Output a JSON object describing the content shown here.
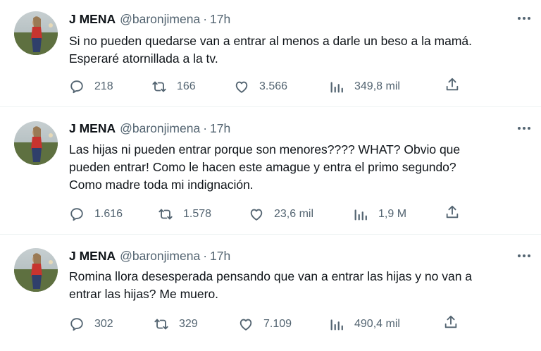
{
  "tweets": [
    {
      "name": "J MENA",
      "handle": "@baronjimena",
      "separator": "·",
      "time": "17h",
      "text": "Si no pueden quedarse van a entrar al menos a darle un beso a la mamá.\nEsperaré atornillada a la tv.",
      "replies": "218",
      "retweets": "166",
      "likes": "3.566",
      "views": "349,8 mil"
    },
    {
      "name": "J MENA",
      "handle": "@baronjimena",
      "separator": "·",
      "time": "17h",
      "text": "Las hijas ni pueden entrar porque son menores???? WHAT? Obvio que\npueden entrar! Como le hacen este amague y entra el primo segundo?\nComo madre toda mi indignación.",
      "replies": "1.616",
      "retweets": "1.578",
      "likes": "23,6 mil",
      "views": "1,9 M"
    },
    {
      "name": "J MENA",
      "handle": "@baronjimena",
      "separator": "·",
      "time": "17h",
      "text": "Romina llora desesperada pensando que van a entrar las hijas y no van a\nentrar las hijas? Me muero.",
      "replies": "302",
      "retweets": "329",
      "likes": "7.109",
      "views": "490,4 mil"
    }
  ],
  "icons": {
    "reply": "reply-icon",
    "retweet": "retweet-icon",
    "like": "heart-icon",
    "views": "views-icon",
    "share": "share-icon",
    "more": "more-icon"
  },
  "colors": {
    "text": "#0f1419",
    "secondary": "#536471",
    "divider": "#eff3f4"
  }
}
